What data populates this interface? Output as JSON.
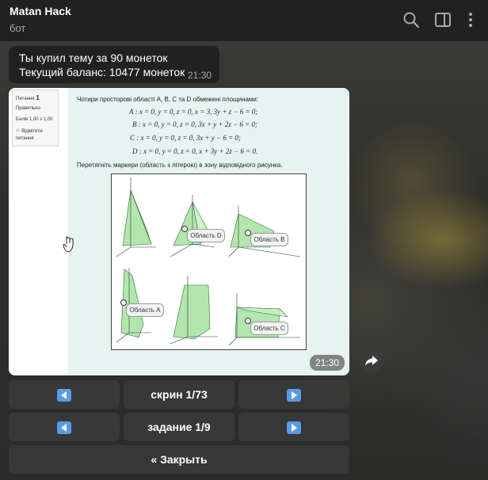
{
  "header": {
    "title": "Matan Hack",
    "subtitle": "бот",
    "icons": [
      "search-icon",
      "sidebar-toggle-icon",
      "more-vertical-icon"
    ]
  },
  "message1": {
    "line1": "Ты купил тему за 90 монеток",
    "line2": "Текущий баланс: 10477 монеток",
    "time": "21:30"
  },
  "photo_message": {
    "time": "21:30",
    "question_panel": {
      "label": "Питання",
      "number": "1",
      "status": "Правильно",
      "score": "Балів 1,00 з 1,00",
      "flag_line1": "Відмітити",
      "flag_line2": "питання"
    },
    "problem": {
      "intro": "Чотири просторові області A, B, C та D обмежені площинами:",
      "eq_a": "A : x = 0,  y = 0,  z = 0,  x = 3,  3y + z − 6 = 0;",
      "eq_b": "B : x = 0,  y = 0,  z = 0,  3x + y + 2z − 6 = 0;",
      "eq_c": "C : x = 0,  y = 0,  z = 0,  3x + y − 6 = 0;",
      "eq_d": "D : x = 0,  y = 0,  z = 0,  x + 3y + 2z − 6 = 0.",
      "instruction": "Перетягніть маркери (область з літерою) в зону відповідного рисунка."
    },
    "markers": {
      "d": "Область D",
      "b": "Область B",
      "a": "Область A",
      "c": "Область C"
    }
  },
  "keyboard": {
    "screen_label": "скрин 1/73",
    "task_label": "задание 1/9",
    "close_label": "« Закрыть"
  },
  "colors": {
    "topbar": "#212121",
    "bubble": "#212121",
    "keyboard_button": "#3a3a3a",
    "arrow_button_blue": "#4a90e2",
    "region_fill": "#9fe09a"
  }
}
